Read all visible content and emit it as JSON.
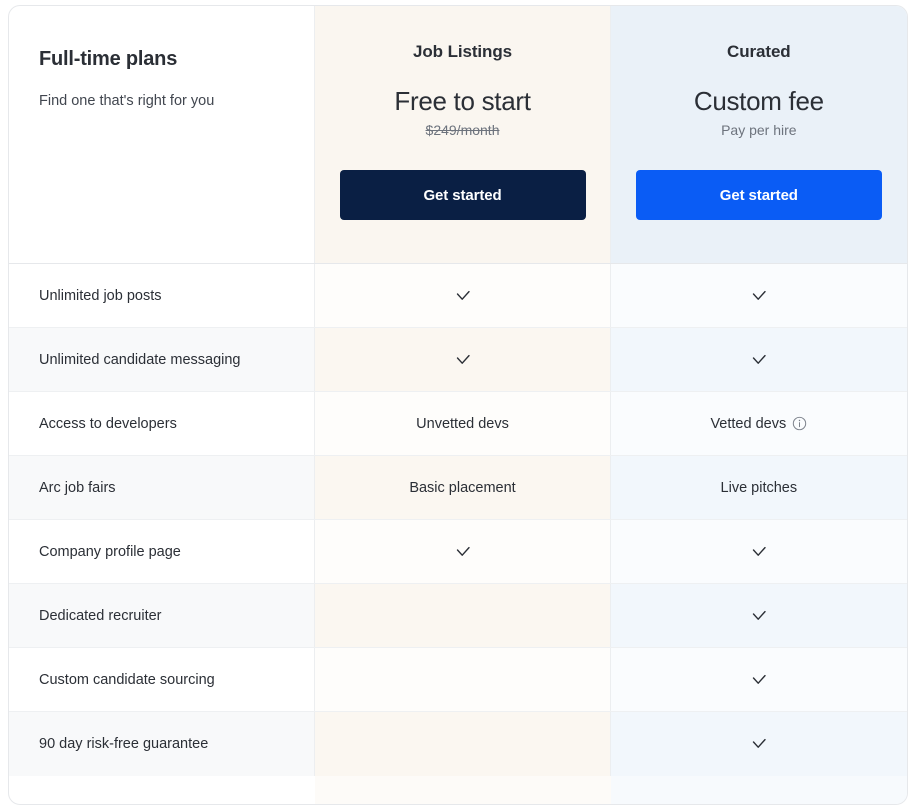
{
  "card": {
    "accents": {
      "dark_button": "#0a1f44",
      "blue_button": "#0a5cf5",
      "mid_column_tint": "#faf6f0",
      "right_column_tint": "#eaf1f8",
      "text": "#2b2f36",
      "muted_text": "#6d737d"
    }
  },
  "header": {
    "plans": {
      "title": "Full-time plans",
      "subtitle": "Find one that's right for you"
    },
    "columns": [
      {
        "name": "Job Listings",
        "price": "Free to start",
        "note": "$249/month",
        "note_style": "strikethrough",
        "cta_label": "Get started"
      },
      {
        "name": "Curated",
        "price": "Custom fee",
        "note": "Pay per hire",
        "note_style": "plain",
        "cta_label": "Get started"
      }
    ]
  },
  "rows": [
    {
      "label": "Unlimited job posts",
      "job_listings": {
        "kind": "check",
        "icon": "check-icon"
      },
      "curated": {
        "kind": "check",
        "icon": "check-icon"
      }
    },
    {
      "label": "Unlimited candidate messaging",
      "job_listings": {
        "kind": "check",
        "icon": "check-icon"
      },
      "curated": {
        "kind": "check",
        "icon": "check-icon"
      }
    },
    {
      "label": "Access to developers",
      "job_listings": {
        "kind": "text",
        "text": "Unvetted devs"
      },
      "curated": {
        "kind": "text",
        "text": "Vetted devs",
        "icon": "info-icon"
      }
    },
    {
      "label": "Arc job fairs",
      "job_listings": {
        "kind": "text",
        "text": "Basic placement"
      },
      "curated": {
        "kind": "text",
        "text": "Live pitches"
      }
    },
    {
      "label": "Company profile page",
      "job_listings": {
        "kind": "check",
        "icon": "check-icon"
      },
      "curated": {
        "kind": "check",
        "icon": "check-icon"
      }
    },
    {
      "label": "Dedicated recruiter",
      "job_listings": {
        "kind": "empty"
      },
      "curated": {
        "kind": "check",
        "icon": "check-icon"
      }
    },
    {
      "label": "Custom candidate sourcing",
      "job_listings": {
        "kind": "empty"
      },
      "curated": {
        "kind": "check",
        "icon": "check-icon"
      }
    },
    {
      "label": "90 day risk-free guarantee",
      "job_listings": {
        "kind": "empty"
      },
      "curated": {
        "kind": "check",
        "icon": "check-icon"
      }
    }
  ]
}
